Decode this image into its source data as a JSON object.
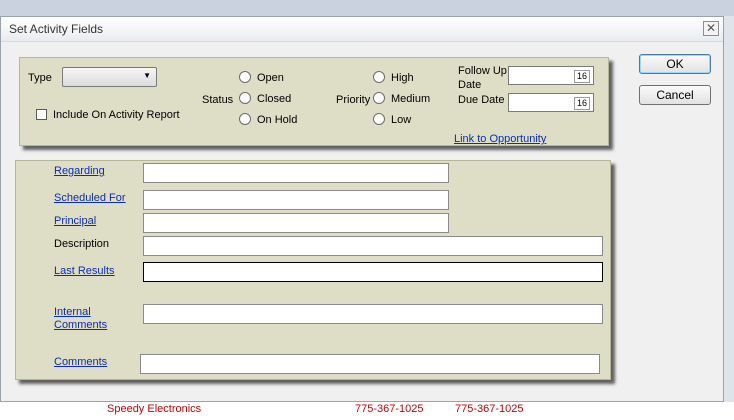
{
  "background": {
    "row_text": "Speedy Electronics",
    "phone_1": "775-367-1025",
    "phone_2": "775-367-1025"
  },
  "dialog": {
    "title": "Set Activity Fields",
    "close_glyph": "✕"
  },
  "top_panel": {
    "type_label": "Type",
    "type_value": "",
    "include_label": "Include On Activity Report",
    "status_label": "Status",
    "status_options": [
      "Open",
      "Closed",
      "On Hold"
    ],
    "priority_label": "Priority",
    "priority_options": [
      "High",
      "Medium",
      "Low"
    ],
    "follow_up_label_line1": "Follow Up",
    "follow_up_label_line2": "Date",
    "follow_up_calendar_day": "16",
    "due_date_label": "Due Date",
    "due_date_calendar_day": "16",
    "link_to_opportunity": "Link to Opportunity"
  },
  "fields": {
    "regarding_label": "Regarding",
    "scheduled_for_label": "Scheduled For",
    "principal_label": "Principal",
    "description_label": "Description",
    "last_results_label": "Last Results",
    "internal_comments_line1": "Internal",
    "internal_comments_line2": "Comments",
    "comments_label": "Comments"
  },
  "buttons": {
    "ok": "OK",
    "cancel": "Cancel"
  }
}
